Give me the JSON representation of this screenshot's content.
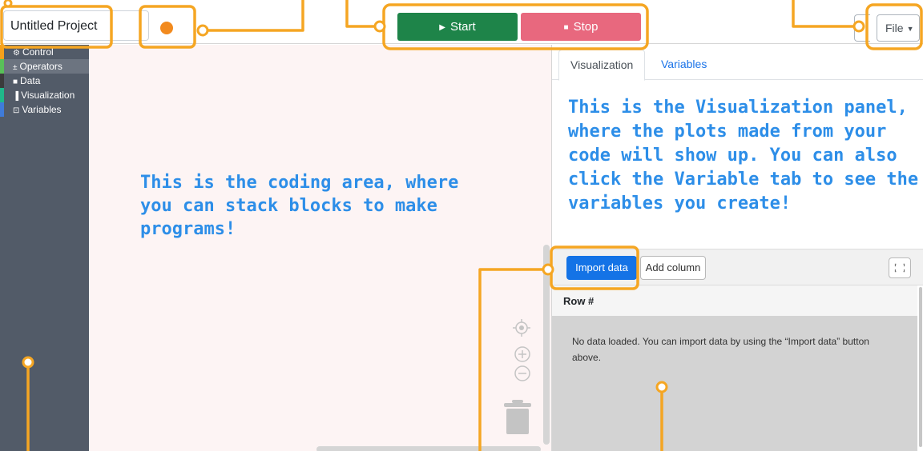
{
  "header": {
    "project_name": "Untitled Project",
    "status_color": "#f28a1e",
    "start_label": "Start",
    "stop_label": "Stop",
    "file_menu_label": "File",
    "start_color": "#1e8449",
    "stop_color": "#e8687e"
  },
  "toolbox": {
    "categories": [
      {
        "label": "Control",
        "glyph": "⚙",
        "color": "#f6a01a"
      },
      {
        "label": "Operators",
        "glyph": "±",
        "color": "#59c059"
      },
      {
        "label": "Data",
        "glyph": "■",
        "color": "#3b3b3b"
      },
      {
        "label": "Visualization",
        "glyph": "▐",
        "color": "#1fb88a"
      },
      {
        "label": "Variables",
        "glyph": "⊡",
        "color": "#3f7bd9"
      }
    ]
  },
  "workspace": {
    "annotation": "This is the coding area, where you can stack blocks to make programs!"
  },
  "panel": {
    "tabs": [
      "Visualization",
      "Variables"
    ],
    "annotation": "This is the Visualization panel, where the plots made from your code will show up. You can also click the Variable tab to see the variables you create!",
    "import_label": "Import data",
    "add_column_label": "Add column",
    "table_header": "Row #",
    "empty_message": "No data loaded. You can import data by using the “Import data” button above."
  },
  "annotation_color": "#f5a623"
}
